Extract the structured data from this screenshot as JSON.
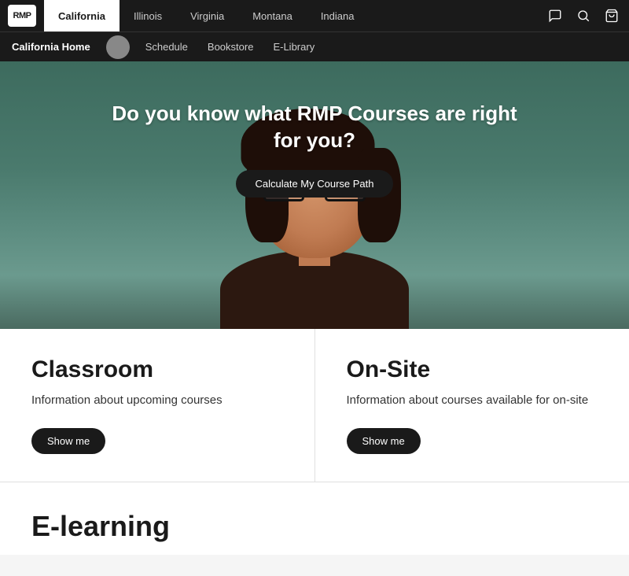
{
  "topNav": {
    "logo": "RMP",
    "tabs": [
      {
        "id": "california",
        "label": "California",
        "active": true
      },
      {
        "id": "illinois",
        "label": "Illinois",
        "active": false
      },
      {
        "id": "virginia",
        "label": "Virginia",
        "active": false
      },
      {
        "id": "montana",
        "label": "Montana",
        "active": false
      },
      {
        "id": "indiana",
        "label": "Indiana",
        "active": false
      }
    ],
    "icons": {
      "chat": "💬",
      "search": "🔍",
      "cart": "🛒"
    }
  },
  "secondaryNav": {
    "home": "California Home",
    "links": [
      "Schedule",
      "Bookstore",
      "E-Library"
    ]
  },
  "hero": {
    "title": "Do you know what RMP Courses are right for you?",
    "button": "Calculate My Course Path"
  },
  "classroom": {
    "title": "Classroom",
    "description": "Information about upcoming courses",
    "button": "Show me"
  },
  "onsite": {
    "title": "On-Site",
    "description": "Information about courses available for on-site",
    "button": "Show me"
  },
  "elearning": {
    "title": "E-learning"
  }
}
